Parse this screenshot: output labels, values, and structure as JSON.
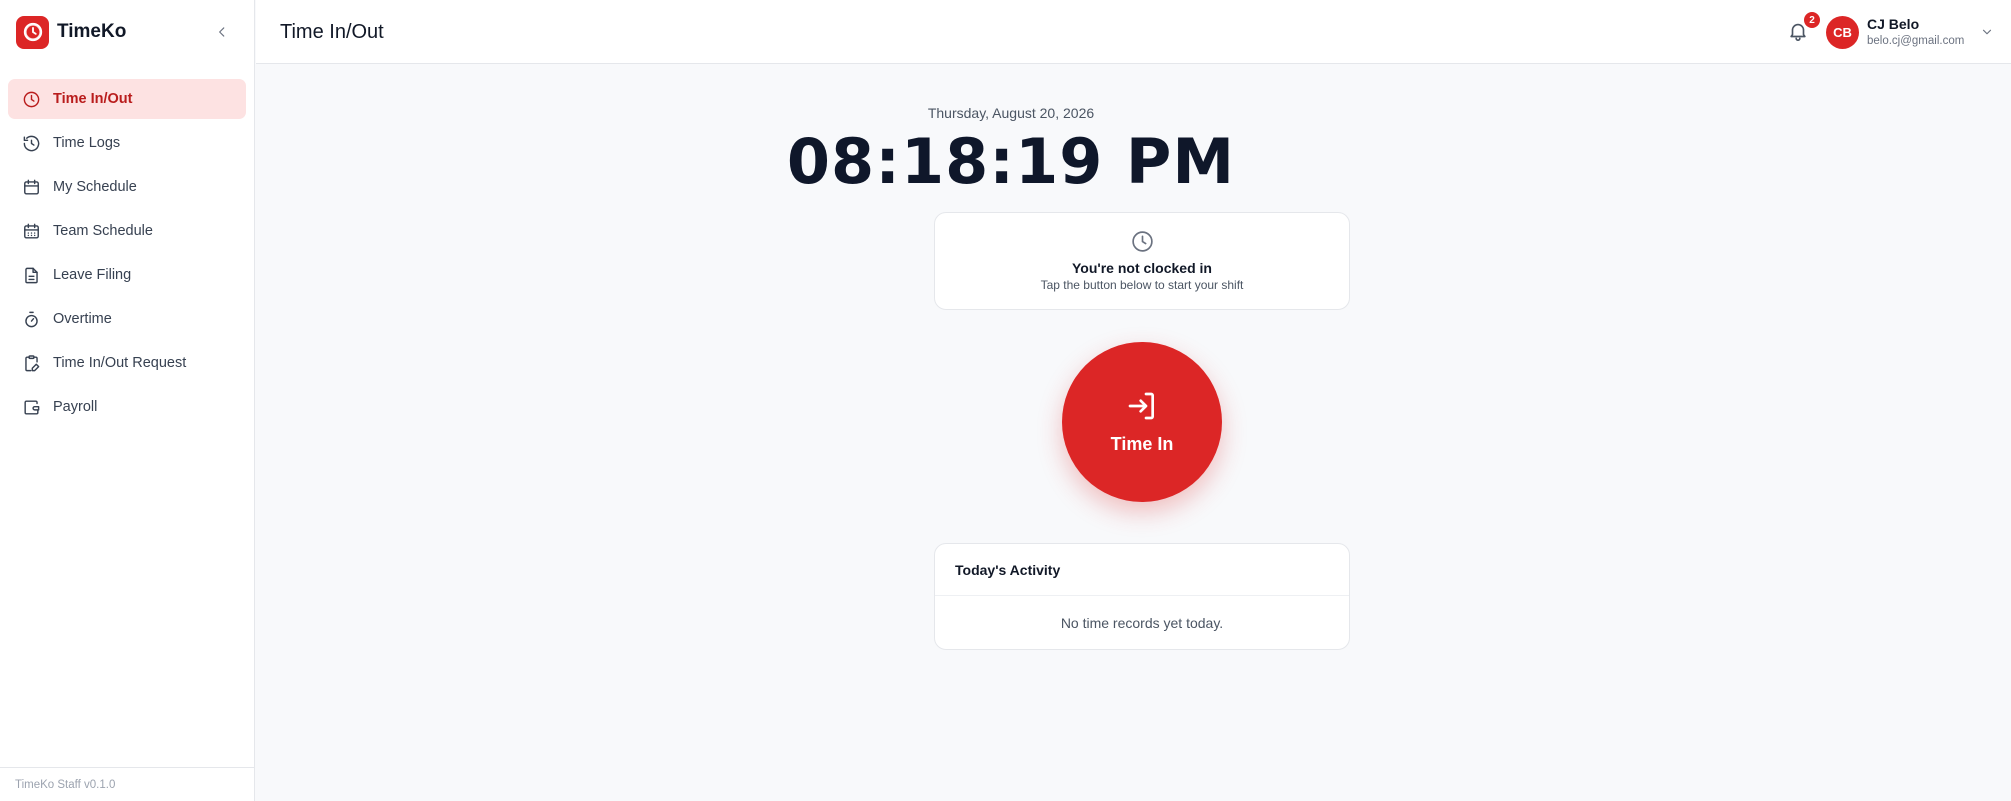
{
  "app": {
    "name": "TimeKo",
    "version_label": "TimeKo Staff v0.1.0",
    "accent_color": "#dc2626"
  },
  "sidebar": {
    "items": [
      {
        "label": "Time In/Out",
        "icon": "clock-icon",
        "active": true
      },
      {
        "label": "Time Logs",
        "icon": "history-icon",
        "active": false
      },
      {
        "label": "My Schedule",
        "icon": "calendar-icon",
        "active": false
      },
      {
        "label": "Team Schedule",
        "icon": "calendar-grid-icon",
        "active": false
      },
      {
        "label": "Leave Filing",
        "icon": "document-icon",
        "active": false
      },
      {
        "label": "Overtime",
        "icon": "stopwatch-icon",
        "active": false
      },
      {
        "label": "Time In/Out Request",
        "icon": "clipboard-edit-icon",
        "active": false
      },
      {
        "label": "Payroll",
        "icon": "wallet-icon",
        "active": false
      }
    ]
  },
  "header": {
    "title": "Time In/Out",
    "notification_count": "2",
    "user": {
      "initials": "CB",
      "name": "CJ Belo",
      "email": "belo.cj@gmail.com"
    }
  },
  "main": {
    "date": "Thursday, August 20, 2026",
    "time": "08:18:19 PM",
    "status": {
      "title": "You're not clocked in",
      "subtitle": "Tap the button below to start your shift"
    },
    "time_in_button_label": "Time In",
    "activity": {
      "title": "Today's Activity",
      "empty_message": "No time records yet today."
    }
  }
}
